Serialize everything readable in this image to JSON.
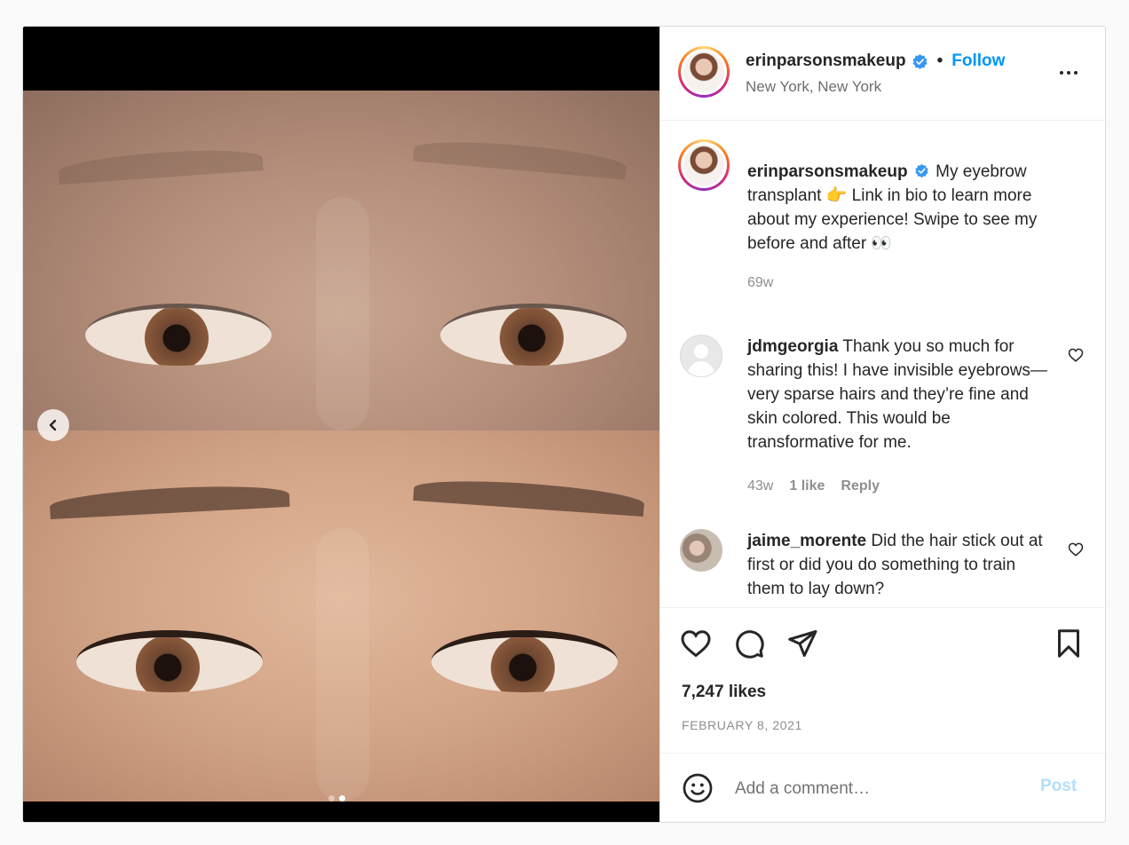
{
  "header": {
    "username": "erinparsonsmakeup",
    "separator": "•",
    "follow_label": "Follow",
    "location": "New York, New York",
    "verified_icon": "verified-badge-icon",
    "more_icon": "more-options-icon"
  },
  "caption": {
    "username": "erinparsonsmakeup",
    "text": "My eyebrow transplant 👉 Link in bio to learn more about my experience! Swipe to see my before and after 👀",
    "age": "69w"
  },
  "comments": [
    {
      "username": "jdmgeorgia",
      "text": "Thank you so much for sharing this! I have invisible eyebrows—very sparse hairs and they’re fine and skin colored. This would be transformative for me.",
      "age": "43w",
      "likes": "1 like",
      "reply_label": "Reply"
    },
    {
      "username": "jaime_morente",
      "text": "Did the hair stick out at first or did you do something to train them to lay down?"
    }
  ],
  "actions": {
    "like_icon": "heart-icon",
    "comment_icon": "comment-icon",
    "share_icon": "share-icon",
    "save_icon": "bookmark-icon",
    "likes_count": "7,247 likes",
    "date": "FEBRUARY 8, 2021"
  },
  "add_comment": {
    "placeholder": "Add a comment…",
    "post_label": "Post",
    "emoji_icon": "emoji-icon"
  },
  "carousel": {
    "slide_count": 2,
    "active_slide": 2,
    "prev_icon": "chevron-left-icon"
  },
  "colors": {
    "accent": "#0095f6",
    "post_disabled": "#b2dffc",
    "secondary_text": "#8e8e8e"
  }
}
